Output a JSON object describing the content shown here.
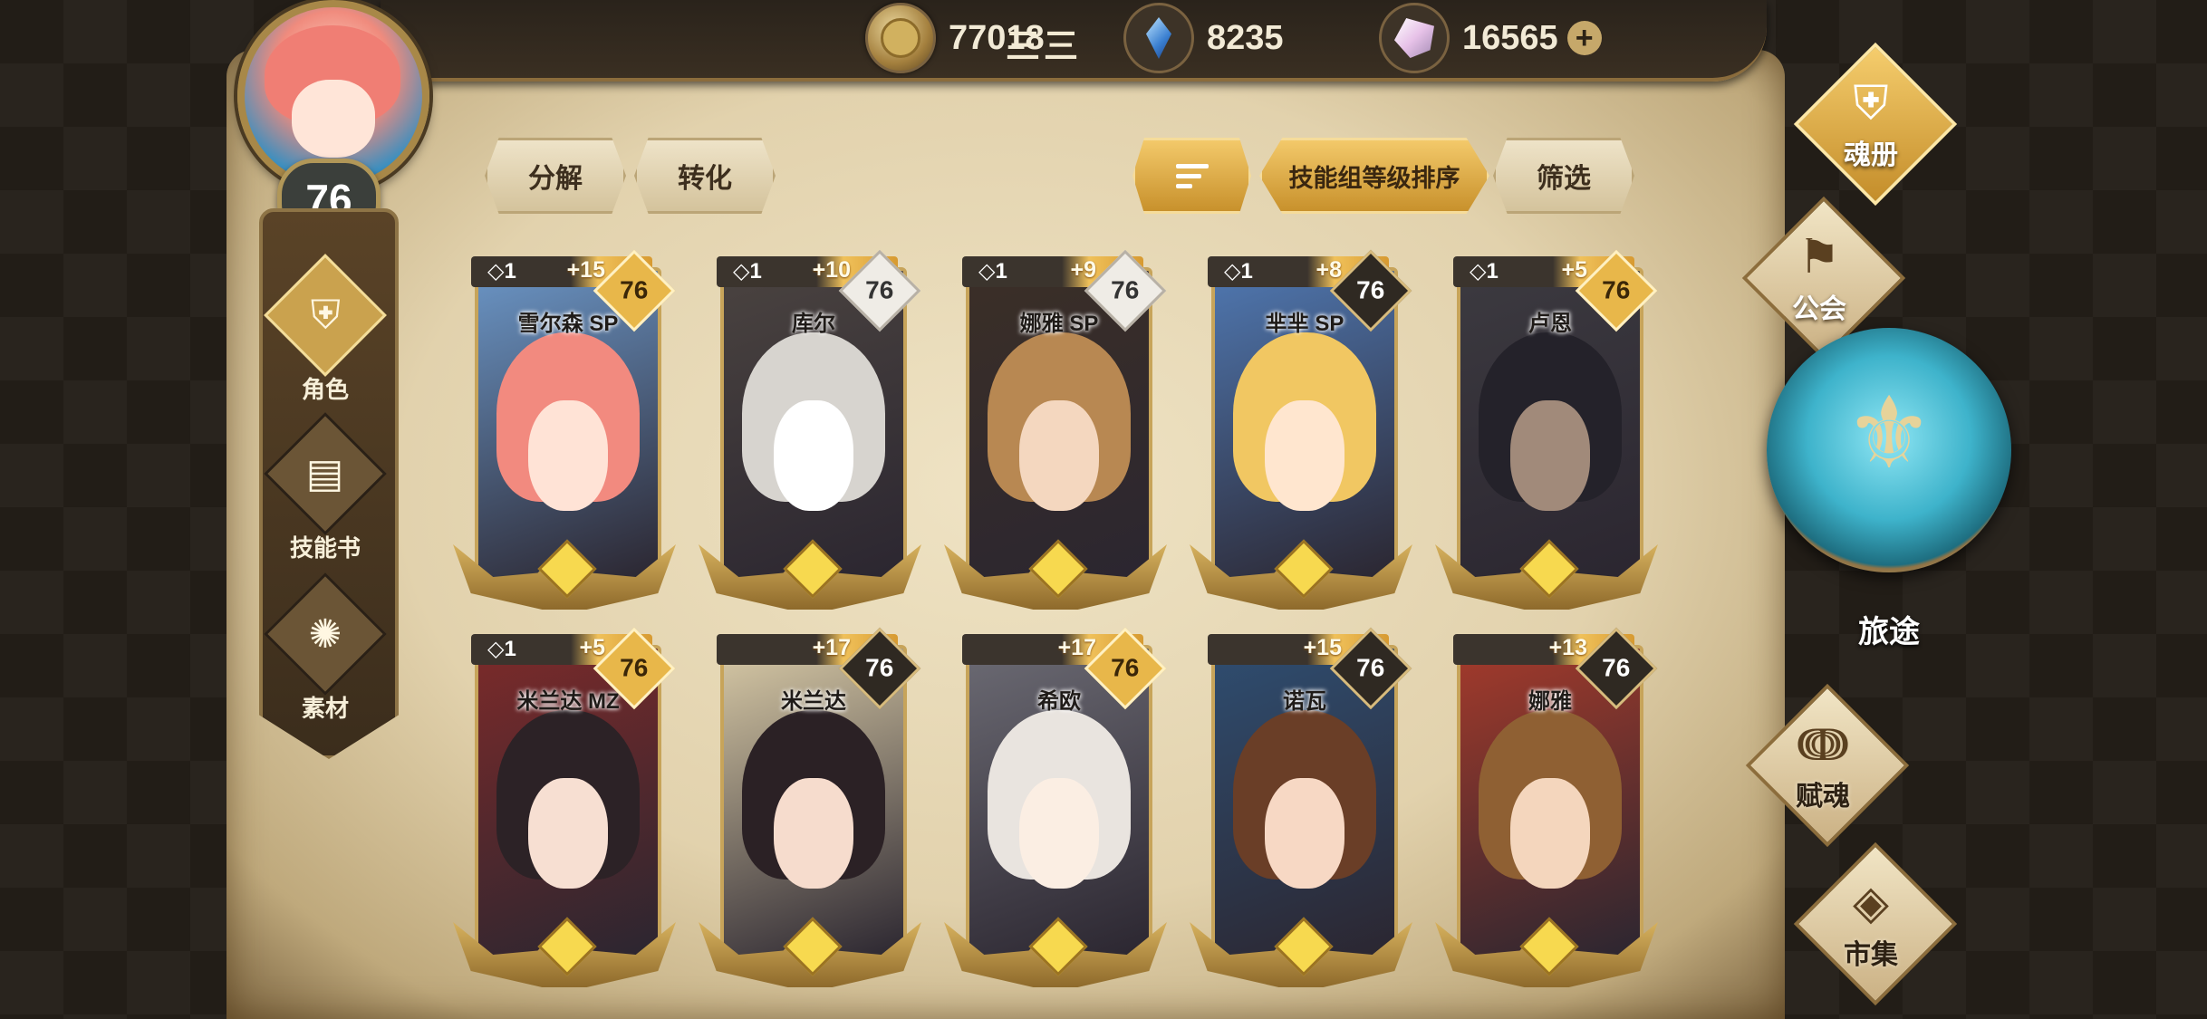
{
  "header": {
    "username": "三三",
    "currencies": [
      {
        "icon": "gold-coin-icon",
        "value": "77018"
      },
      {
        "icon": "blue-crystal-icon",
        "value": "8235"
      },
      {
        "icon": "pink-crystal-icon",
        "value": "16565",
        "plus": "+"
      }
    ]
  },
  "player": {
    "level": "76"
  },
  "left_menu": [
    {
      "icon": "helmet-icon",
      "label": "角色",
      "active": true
    },
    {
      "icon": "skill-book-icon",
      "label": "技能书"
    },
    {
      "icon": "beast-head-icon",
      "label": "素材"
    }
  ],
  "toolbar": {
    "decompose": "分解",
    "convert": "转化",
    "sort_order_icon": "sort-icon",
    "sort_label": "技能组等级排序",
    "filter": "筛选"
  },
  "cards": [
    {
      "name": "雪尔森 SP",
      "star": "◇1",
      "plus": "+15",
      "level": "76",
      "lvl_style": "gold",
      "colors": [
        "#f28a7f",
        "#ffe3d6",
        "#6a94c4"
      ]
    },
    {
      "name": "库尔",
      "star": "◇1",
      "plus": "+10",
      "level": "76",
      "lvl_style": "white",
      "colors": [
        "#d7d4cf",
        "#ffffff",
        "#4a4340"
      ]
    },
    {
      "name": "娜雅 SP",
      "star": "◇1",
      "plus": "+9",
      "level": "76",
      "lvl_style": "white",
      "colors": [
        "#b88852",
        "#f4d7bf",
        "#3b2f27"
      ]
    },
    {
      "name": "芈芈 SP",
      "star": "◇1",
      "plus": "+8",
      "level": "76",
      "lvl_style": "dark",
      "colors": [
        "#f1c762",
        "#ffe6cf",
        "#4f77b0"
      ]
    },
    {
      "name": "卢恩",
      "star": "◇1",
      "plus": "+5",
      "level": "76",
      "lvl_style": "gold",
      "colors": [
        "#24222a",
        "#a18a7a",
        "#3c3a40"
      ]
    },
    {
      "name": "米兰达 MZ",
      "star": "◇1",
      "plus": "+5",
      "level": "76",
      "lvl_style": "gold",
      "colors": [
        "#2c2226",
        "#f7dfd2",
        "#7b2a2a"
      ]
    },
    {
      "name": "米兰达",
      "star": "",
      "plus": "+17",
      "level": "76",
      "lvl_style": "dark",
      "colors": [
        "#2b2125",
        "#f6dccd",
        "#d6c8a5"
      ]
    },
    {
      "name": "希欧",
      "star": "",
      "plus": "+17",
      "level": "76",
      "lvl_style": "gold",
      "colors": [
        "#e9e4df",
        "#fbeee3",
        "#6b6a73"
      ]
    },
    {
      "name": "诺瓦",
      "star": "",
      "plus": "+15",
      "level": "76",
      "lvl_style": "dark",
      "colors": [
        "#6a3e27",
        "#f7d8c4",
        "#2f4d70"
      ]
    },
    {
      "name": "娜雅",
      "star": "",
      "plus": "+13",
      "level": "76",
      "lvl_style": "dark",
      "colors": [
        "#8f6033",
        "#f4d6bd",
        "#a33a2b"
      ]
    }
  ],
  "right_menu": [
    {
      "icon": "helmet-icon",
      "label": "魂册",
      "style": "gold"
    },
    {
      "icon": "guild-banner-icon",
      "label": "公会",
      "style": "light"
    },
    {
      "icon": "soul-flame-icon",
      "label": "赋魂",
      "style": "light"
    },
    {
      "icon": "gem-icon",
      "label": "市集",
      "style": "light"
    }
  ],
  "journey": {
    "icon": "trident-emblem-icon",
    "label": "旅途"
  }
}
